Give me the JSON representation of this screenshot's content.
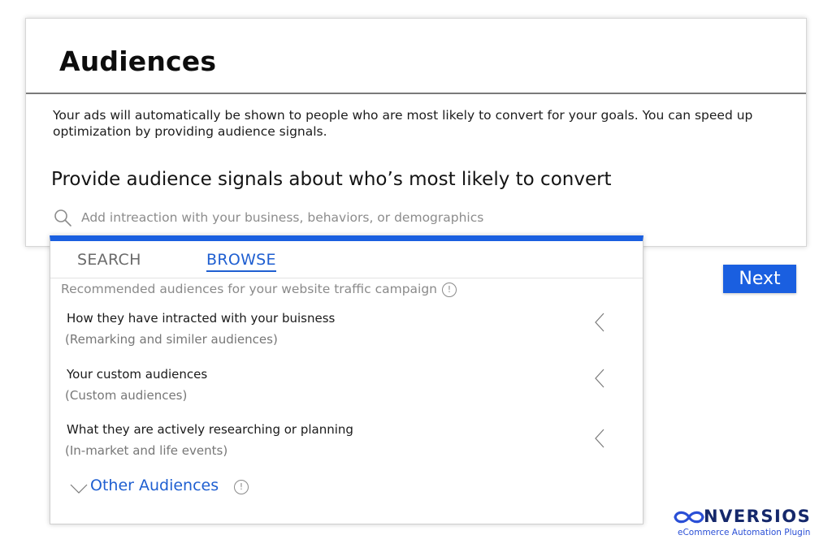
{
  "card": {
    "title": "Audiences",
    "description": "Your ads will automatically be shown to people who are most likely to convert for your goals. You can speed up optimization by providing audience signals.",
    "heading": "Provide audience signals about who’s most likely to convert",
    "search": {
      "placeholder": "Add intreaction with your business, behaviors, or demographics",
      "value": ""
    }
  },
  "dropdown": {
    "tabs": [
      {
        "label": "SEARCH",
        "active": false
      },
      {
        "label": "BROWSE",
        "active": true
      }
    ],
    "recommended_label": "Recommended audiences for your website traffic campaign",
    "info_glyph": "!",
    "items": [
      {
        "title": "How they have intracted with your buisness",
        "subtitle": "(Remarking and similer audiences)"
      },
      {
        "title": "Your custom audiences",
        "subtitle": "(Custom audiences)"
      },
      {
        "title": "What they are actively researching or planning",
        "subtitle": "(In-market and life events)"
      }
    ],
    "other_label": "Other Audiences"
  },
  "next_label": "Next",
  "brand": {
    "name": "NVERSIOS",
    "tagline": "eCommerce Automation Plugin"
  },
  "colors": {
    "accent": "#1a5fe0",
    "brand": "#15286b",
    "muted": "#8a8a8a"
  },
  "icons": {
    "search": "search-icon",
    "info": "info-icon",
    "chevron_left": "chevron-left-icon",
    "chevron_down": "chevron-down-icon",
    "logo": "infinity-logo-icon"
  }
}
